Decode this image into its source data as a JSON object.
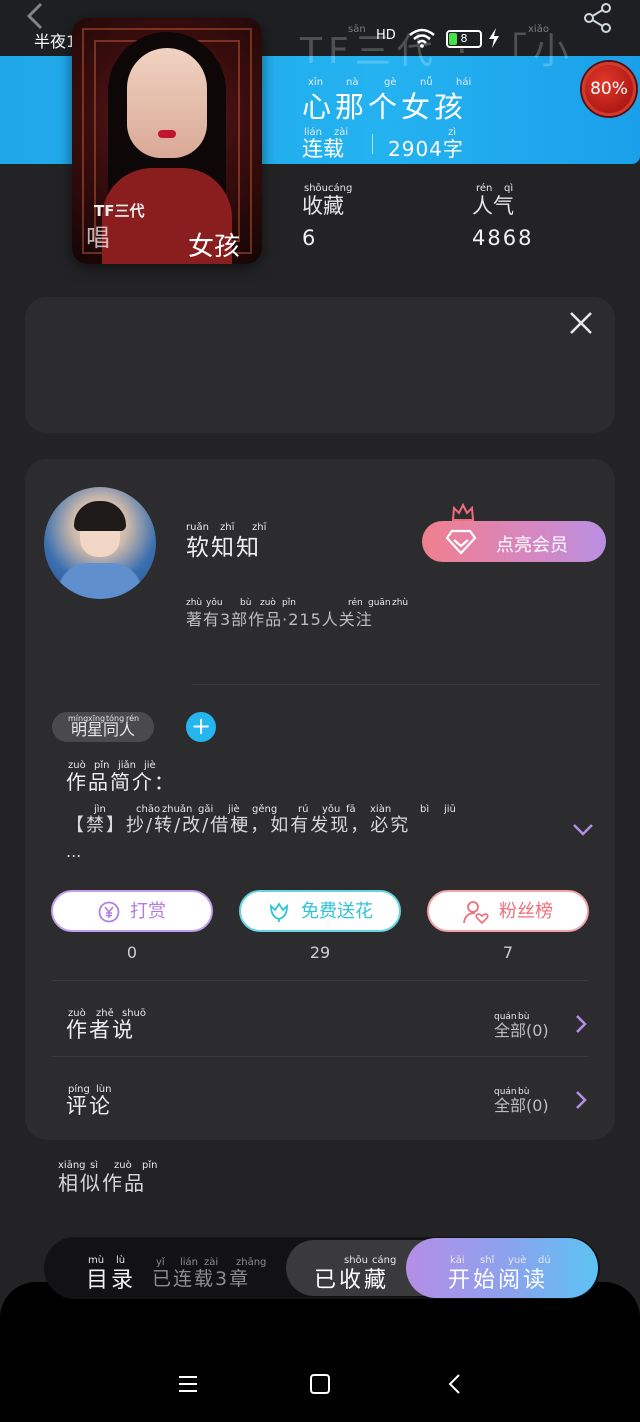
{
  "header": {
    "ghost_title": "TF三代 · 「小",
    "ghost_pinyin": [
      "sān",
      "xiǎo"
    ],
    "back_icon": "back-arrow-icon",
    "share_icon": "share-icon"
  },
  "status_bar": {
    "time": "半夜12:03",
    "more": "•••",
    "network": "HD",
    "battery": "8"
  },
  "book": {
    "cover_text_left": "TF三代",
    "cover_text_mid": "唱",
    "cover_text_big": "女孩",
    "title": "心那个女孩",
    "title_pinyin": [
      "xīn",
      "nà",
      "gè",
      "nǚ",
      "hái"
    ],
    "status": "连载",
    "status_pinyin": [
      "lián",
      "zài"
    ],
    "word_count": "2904字",
    "word_count_pinyin": "zì",
    "progress_badge": "80%",
    "favorites_label": "收藏",
    "favorites_pinyin": [
      "shōu",
      "cáng"
    ],
    "favorites_value": "6",
    "popularity_label": "人气",
    "popularity_pinyin": [
      "rén",
      "qì"
    ],
    "popularity_value": "4868"
  },
  "author": {
    "name": "软知知",
    "name_pinyin": [
      "ruǎn",
      "zhī",
      "zhī"
    ],
    "meta": "著有3部作品·215人关注",
    "meta_pinyin": [
      "zhù",
      "yǒu",
      "bù",
      "zuò",
      "pǐn",
      "rén",
      "guān",
      "zhù"
    ],
    "vip_button": "点亮会员"
  },
  "work": {
    "tag": "明星同人",
    "tag_pinyin": [
      "míng",
      "xīng",
      "tóng",
      "rén"
    ],
    "add_tag": "+",
    "intro_title": "作品简介：",
    "intro_title_pinyin": [
      "zuò",
      "pǐn",
      "jiǎn",
      "jiè"
    ],
    "intro_text": "【禁】抄/转/改/借梗，如有发现，必究",
    "intro_text_pinyin": [
      "jìn",
      "chāo",
      "zhuǎn",
      "gǎi",
      "jiè",
      "gěng",
      "rú",
      "yǒu",
      "fā",
      "xiàn",
      "bì",
      "jiū"
    ],
    "intro_ellipsis": "..."
  },
  "actions": [
    {
      "label": "打赏",
      "count": "0",
      "icon": "yen-coin-icon",
      "color": "#b07ee0"
    },
    {
      "label": "免费送花",
      "count": "29",
      "icon": "flower-icon",
      "color": "#2fc3d8"
    },
    {
      "label": "粉丝榜",
      "count": "7",
      "icon": "fan-heart-icon",
      "color": "#ef6f78"
    }
  ],
  "rows": [
    {
      "title": "作者说",
      "title_pinyin": [
        "zuò",
        "zhě",
        "shuō"
      ],
      "meta": "全部(0)",
      "meta_pinyin": [
        "quán",
        "bù"
      ]
    },
    {
      "title": "评论",
      "title_pinyin": [
        "píng",
        "lùn"
      ],
      "meta": "全部(0)",
      "meta_pinyin": [
        "quán",
        "bù"
      ]
    }
  ],
  "similar": {
    "title": "相似作品",
    "pinyin": [
      "xiāng",
      "sì",
      "zuò",
      "pǐn"
    ]
  },
  "bottom_bar": {
    "toc": "目录",
    "toc_pinyin": [
      "mù",
      "lù"
    ],
    "serial": "已连载3章",
    "serial_pinyin": [
      "yǐ",
      "lián",
      "zài",
      "zhāng"
    ],
    "collected": "已收藏",
    "collected_pinyin": [
      "shōu",
      "cáng"
    ],
    "read": "开始阅读",
    "read_pinyin": [
      "kāi",
      "shǐ",
      "yuè",
      "dú"
    ]
  },
  "colors": {
    "header_blue": "#24b2f0",
    "accent_purple": "#b58ee6",
    "card_bg": "#2c2c2e",
    "page_bg": "#232325"
  }
}
